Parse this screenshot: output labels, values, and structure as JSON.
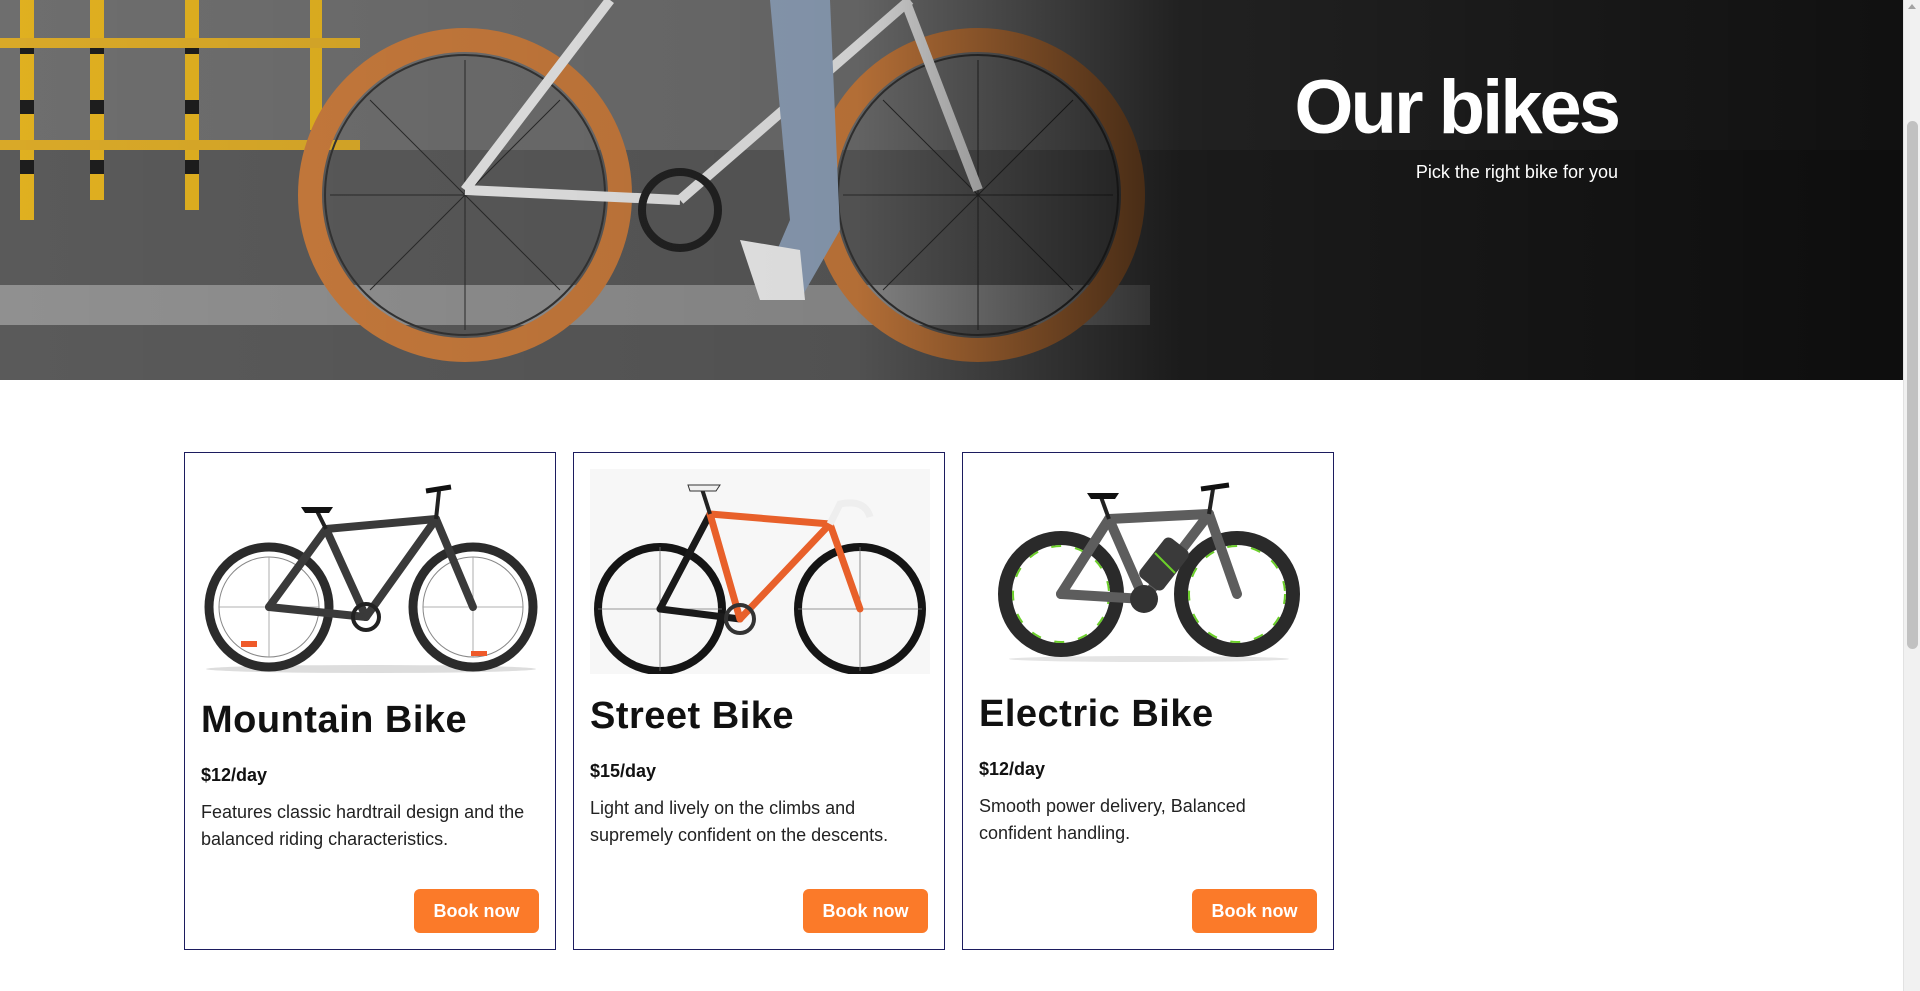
{
  "hero": {
    "title": "Our bikes",
    "subtitle": "Pick the right bike for you"
  },
  "colors": {
    "accent": "#fb7a29",
    "card_border": "#1c1c5e",
    "hero_dark": "#1e1e1e"
  },
  "bikes": [
    {
      "image_icon": "mountain-bike-image",
      "name": "Mountain Bike",
      "price": "$12/day",
      "description": "Features classic hardtrail design and the balanced riding characteristics.",
      "button_label": "Book now"
    },
    {
      "image_icon": "street-bike-image",
      "name": "Street Bike",
      "price": "$15/day",
      "description": "Light and lively on the climbs and supremely confident on the descents.",
      "button_label": "Book now"
    },
    {
      "image_icon": "electric-bike-image",
      "name": "Electric Bike",
      "price": "$12/day",
      "description": "Smooth power delivery, Balanced confident handling.",
      "button_label": "Book now"
    }
  ]
}
